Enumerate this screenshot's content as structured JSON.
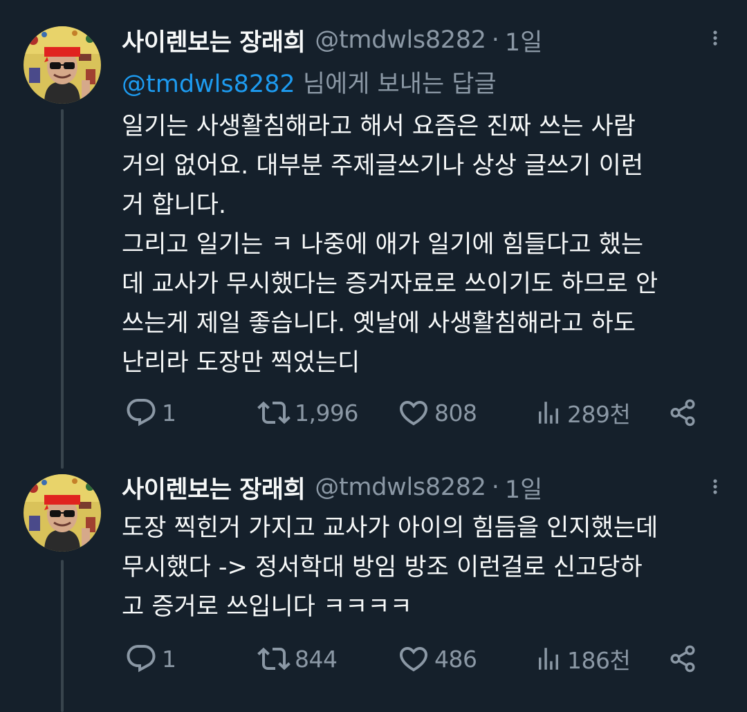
{
  "tweets": [
    {
      "author_name": "사이렌보는 장래희",
      "handle": "@tmdwls8282",
      "separator": "·",
      "time": "1일",
      "reply_to_mention": "@tmdwls8282",
      "reply_to_suffix": " 님에게 보내는 답글",
      "body_lines": [
        "일기는 사생활침해라고 해서 요즘은 진짜 쓰는 사람",
        "거의 없어요. 대부분 주제글쓰기나 상상 글쓰기 이런",
        "거 합니다.",
        "그리고 일기는 ㅋ 나중에 애가 일기에 힘들다고 했는",
        "데 교사가 무시했다는 증거자료로 쓰이기도 하므로 안",
        "쓰는게 제일 좋습니다. 옛날에 사생활침해라고 하도",
        "난리라 도장만 찍었는디"
      ],
      "stats": {
        "replies": "1",
        "retweets": "1,996",
        "likes": "808",
        "views": "289천"
      }
    },
    {
      "author_name": "사이렌보는 장래희",
      "handle": "@tmdwls8282",
      "separator": "·",
      "time": "1일",
      "body_lines": [
        "도장 찍힌거 가지고 교사가 아이의 힘듬을 인지했는데",
        "무시했다 -> 정서학대 방임 방조 이런걸로 신고당하",
        "고 증거로 쓰입니다 ㅋㅋㅋㅋ"
      ],
      "stats": {
        "replies": "1",
        "retweets": "844",
        "likes": "486",
        "views": "186천"
      }
    }
  ],
  "icons": {
    "reply": "reply-icon",
    "retweet": "retweet-icon",
    "like": "heart-icon",
    "views": "views-chart-icon",
    "share": "share-icon",
    "more": "more-options-icon"
  },
  "colors": {
    "background": "#15202b",
    "text": "#f7f9f9",
    "secondary": "#8b98a5",
    "link": "#1d9bf0",
    "thread_line": "#38444d"
  }
}
